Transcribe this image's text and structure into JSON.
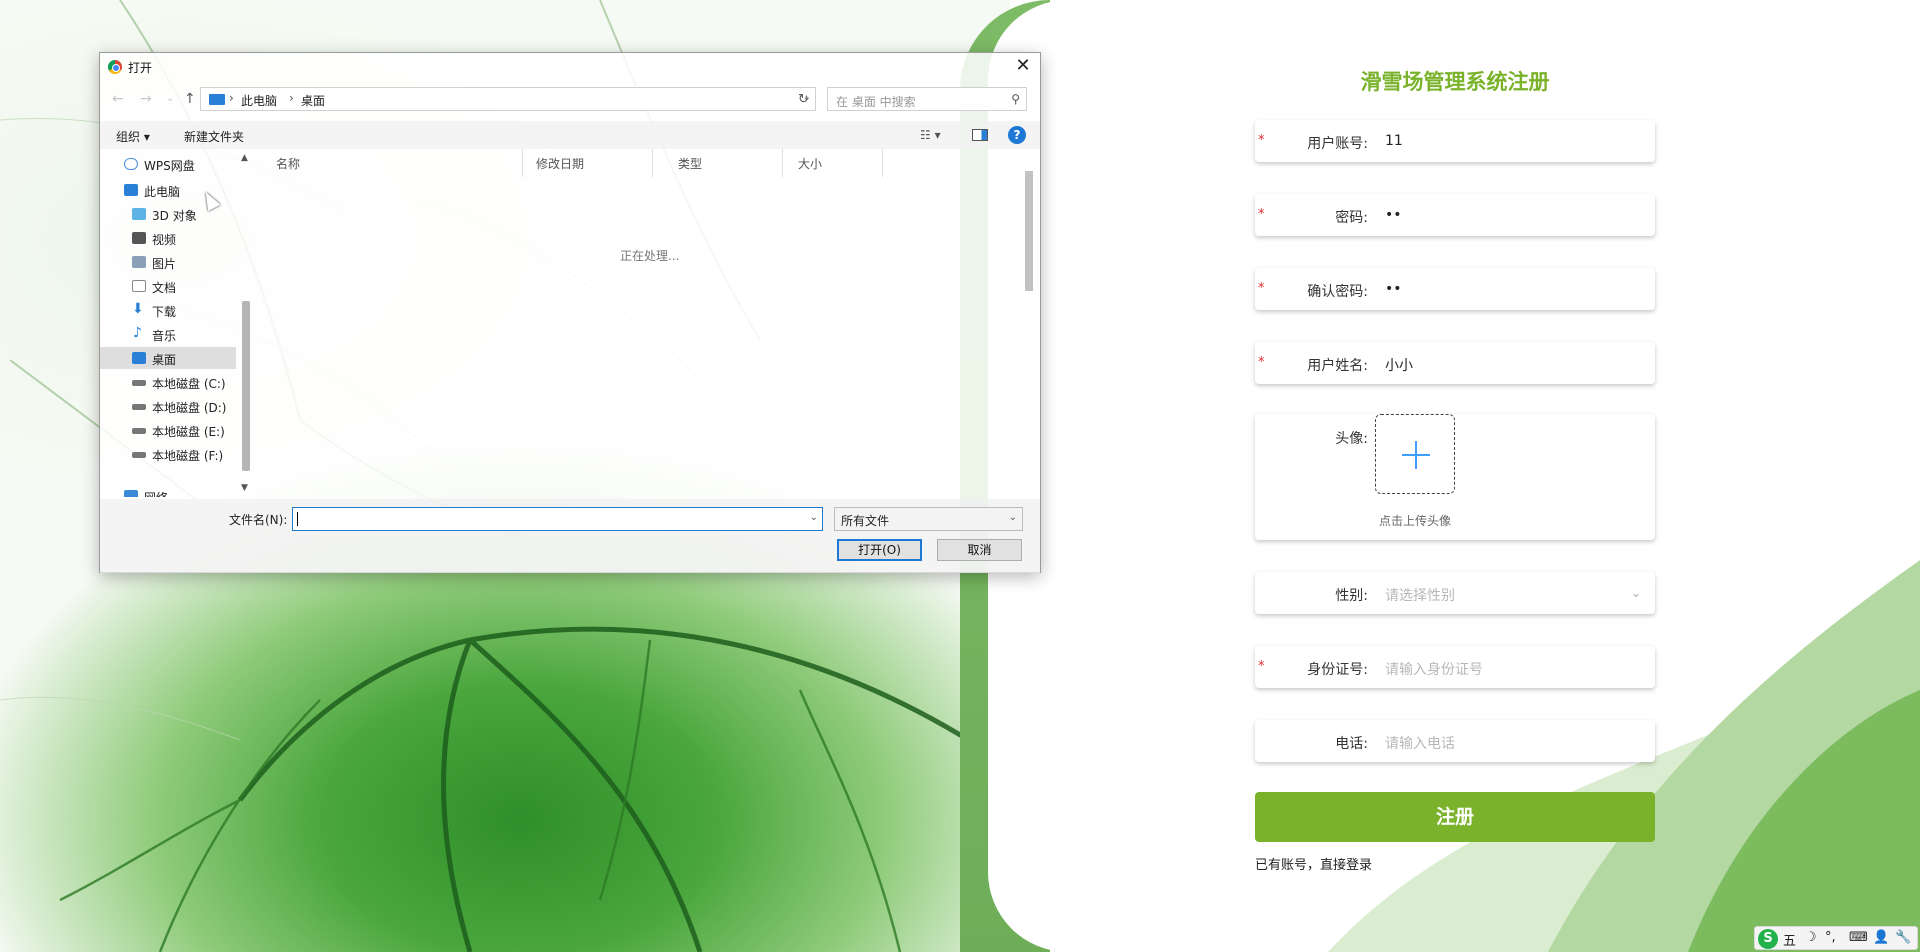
{
  "register": {
    "title": "滑雪场管理系统注册",
    "fields": [
      {
        "label": "用户账号:",
        "value": "11",
        "required": "*"
      },
      {
        "label": "密码:",
        "value": "••",
        "required": "*"
      },
      {
        "label": "确认密码:",
        "value": "••",
        "required": "*"
      },
      {
        "label": "用户姓名:",
        "value": "小小",
        "required": "*"
      }
    ],
    "avatar": {
      "label": "头像:",
      "tip": "点击上传头像"
    },
    "gender": {
      "label": "性别:",
      "placeholder": "请选择性别"
    },
    "id_card": {
      "label": "身份证号:",
      "placeholder": "请输入身份证号",
      "required": "*"
    },
    "phone": {
      "label": "电话:",
      "placeholder": "请输入电话"
    },
    "submit_label": "注册",
    "login_link": "已有账号，直接登录",
    "accent_color": "#7ab32b"
  },
  "dialog": {
    "title": "打开",
    "breadcrumb": [
      "此电脑",
      "桌面"
    ],
    "search_placeholder": "在 桌面 中搜索",
    "toolbar": {
      "organize": "组织 ▾",
      "new_folder": "新建文件夹",
      "help": "?"
    },
    "nav_items": [
      {
        "label": "WPS网盘",
        "icon": "cloud-icon"
      },
      {
        "label": "此电脑",
        "icon": "computer-icon"
      },
      {
        "label": "3D 对象",
        "icon": "cube-icon"
      },
      {
        "label": "视频",
        "icon": "video-icon"
      },
      {
        "label": "图片",
        "icon": "picture-icon"
      },
      {
        "label": "文档",
        "icon": "document-icon"
      },
      {
        "label": "下载",
        "icon": "download-icon"
      },
      {
        "label": "音乐",
        "icon": "music-icon"
      },
      {
        "label": "桌面",
        "icon": "desktop-icon"
      },
      {
        "label": "本地磁盘 (C:)",
        "icon": "drive-icon"
      },
      {
        "label": "本地磁盘 (D:)",
        "icon": "drive-icon"
      },
      {
        "label": "本地磁盘 (E:)",
        "icon": "drive-icon"
      },
      {
        "label": "本地磁盘 (F:)",
        "icon": "drive-icon"
      },
      {
        "label": "网络",
        "icon": "network-icon"
      }
    ],
    "columns": [
      "名称",
      "修改日期",
      "类型",
      "大小"
    ],
    "processing_text": "正在处理...",
    "filename_label": "文件名(N):",
    "filename_value": "",
    "file_type": "所有文件",
    "open_button": "打开(O)",
    "cancel_button": "取消"
  },
  "ime": {
    "logo": "S",
    "mode": "五",
    "items": [
      "☽",
      "°,",
      "⌨",
      "👤",
      "🔧"
    ]
  }
}
